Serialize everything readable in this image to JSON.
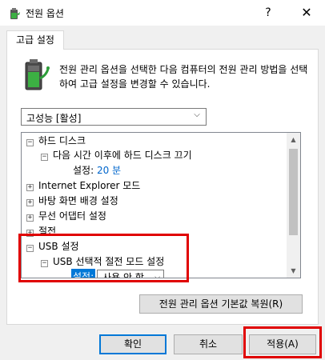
{
  "window": {
    "title": "전원 옵션",
    "help_glyph": "?",
    "close_glyph": "✕"
  },
  "tab": {
    "label": "고급 설정"
  },
  "description": "전원 관리 옵션을 선택한 다음 컴퓨터의 전원 관리 방법을 선택하여 고급 설정을 변경할 수 있습니다.",
  "plan_select": {
    "value": "고성능 [활성]"
  },
  "tree": {
    "rows": [
      {
        "expander": "−",
        "label": "하드 디스크"
      },
      {
        "expander": "−",
        "label": "다음 시간 이후에 하드 디스크 끄기"
      },
      {
        "setting_label": "설정:",
        "setting_value": "20 분"
      },
      {
        "expander": "+",
        "label": "Internet Explorer 모드"
      },
      {
        "expander": "+",
        "label": "바탕 화면 배경 설정"
      },
      {
        "expander": "+",
        "label": "무선 어댑터 설정"
      },
      {
        "expander": "+",
        "label": "절전"
      },
      {
        "expander": "−",
        "label": "USB 설정"
      },
      {
        "expander": "−",
        "label": "USB 선택적 절전 모드 설정"
      },
      {
        "setting_label": "설정:",
        "setting_value": "사용 안 함"
      }
    ]
  },
  "buttons": {
    "restore": "전원 관리 옵션 기본값 복원(R)",
    "ok": "확인",
    "cancel": "취소",
    "apply": "적용(A)"
  },
  "colors": {
    "accent": "#0078d7",
    "highlight_border": "#e00000",
    "link": "#0066cc"
  }
}
